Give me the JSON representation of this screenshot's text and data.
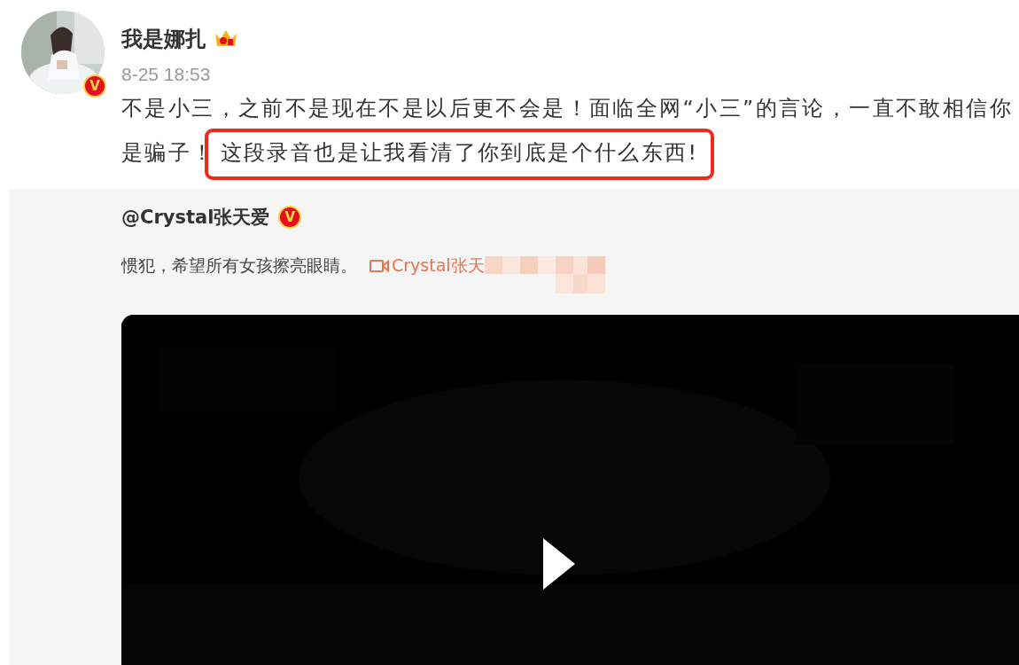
{
  "post": {
    "author": "我是娜扎",
    "verified_mark": "V",
    "time": "8-25 18:53",
    "text": "不是小三，之前不是现在不是以后更不会是！面临全网“小三”的言论，一直不敢相信你是骗子！",
    "highlighted_text": "这段录音也是让我看清了你到底是个什么东西!"
  },
  "repost": {
    "author": "@Crystal张天爱",
    "verified_mark": "V",
    "text": "惯犯，希望所有女孩擦亮眼睛。",
    "video_link": "Crystal张天"
  }
}
